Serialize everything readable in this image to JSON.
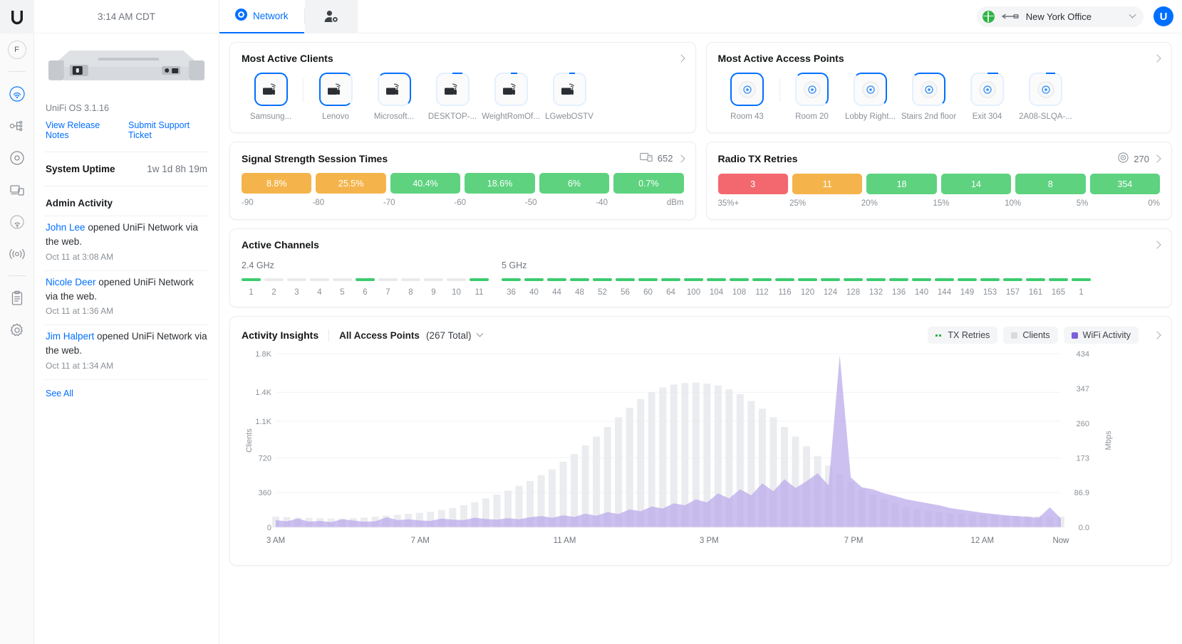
{
  "rail": {
    "logo_icon": "ubiquiti-logo-icon",
    "avatar_initial": "F",
    "items": [
      {
        "name": "wifi-dashboard-icon",
        "active": true
      },
      {
        "name": "topology-icon",
        "active": false
      },
      {
        "name": "devices-circle-icon",
        "active": false
      },
      {
        "name": "client-devices-icon",
        "active": false
      },
      {
        "name": "wifi-coverage-icon",
        "active": false
      },
      {
        "name": "radio-broadcast-icon",
        "active": false
      },
      {
        "name": "logs-clipboard-icon",
        "active": false
      },
      {
        "name": "settings-gear-icon",
        "active": false
      }
    ]
  },
  "topbar": {
    "tab_network": "Network",
    "tab_admin_icon": "user-admin-icon",
    "site_name": "New York Office",
    "site_status_icon": "globe-online-icon",
    "user_avatar_initial": "U"
  },
  "sidebar": {
    "clock": "3:14 AM CDT",
    "device_icon": "rackmount-gateway-icon",
    "os_version": "UniFi OS 3.1.16",
    "link_release_notes": "View Release Notes",
    "link_support_ticket": "Submit Support Ticket",
    "uptime_label": "System Uptime",
    "uptime_value": "1w 1d 8h 19m",
    "admin_activity_title": "Admin Activity",
    "activities": [
      {
        "user": "John Lee",
        "text": " opened UniFi Network via the web.",
        "time": "Oct 11 at 3:08 AM"
      },
      {
        "user": "Nicole Deer",
        "text": " opened UniFi Network via the web.",
        "time": "Oct 11 at 1:36 AM"
      },
      {
        "user": "Jim Halpert",
        "text": " opened UniFi Network via the web.",
        "time": "Oct 11 at 1:34 AM"
      }
    ],
    "see_all": "See All"
  },
  "most_active_clients": {
    "title": "Most Active Clients",
    "items": [
      {
        "label": "Samsung...",
        "ring": 100,
        "selected": true
      },
      {
        "label": "Lenovo",
        "ring": 78,
        "selected": false
      },
      {
        "label": "Microsoft...",
        "ring": 42,
        "selected": false
      },
      {
        "label": "DESKTOP-...",
        "ring": 12,
        "selected": false
      },
      {
        "label": "WeightRomOf...",
        "ring": 8,
        "selected": false
      },
      {
        "label": "LGwebOSTV",
        "ring": 7,
        "selected": false
      }
    ]
  },
  "most_active_aps": {
    "title": "Most Active Access Points",
    "items": [
      {
        "label": "Room 43",
        "ring": 100,
        "selected": true
      },
      {
        "label": "Room 20",
        "ring": 52,
        "selected": false
      },
      {
        "label": "Lobby Right...",
        "ring": 46,
        "selected": false
      },
      {
        "label": "Stairs 2nd floor",
        "ring": 40,
        "selected": false
      },
      {
        "label": "Exit 304",
        "ring": 18,
        "selected": false
      },
      {
        "label": "2A08-SLQA-...",
        "ring": 16,
        "selected": false
      }
    ]
  },
  "signal_strength": {
    "title": "Signal Strength Session Times",
    "metric_icon": "clients-screen-icon",
    "metric_value": "652",
    "segments": [
      {
        "value": "8.8%",
        "color": "#f5b44b"
      },
      {
        "value": "25.5%",
        "color": "#f5b44b"
      },
      {
        "value": "40.4%",
        "color": "#5ed27f"
      },
      {
        "value": "18.6%",
        "color": "#5ed27f"
      },
      {
        "value": "6%",
        "color": "#5ed27f"
      },
      {
        "value": "0.7%",
        "color": "#5ed27f"
      }
    ],
    "ticks": [
      "-90",
      "-80",
      "-70",
      "-60",
      "-50",
      "-40"
    ],
    "unit": "dBm"
  },
  "radio_tx_retries": {
    "title": "Radio TX Retries",
    "metric_icon": "access-point-target-icon",
    "metric_value": "270",
    "segments": [
      {
        "value": "3",
        "color": "#f2686e"
      },
      {
        "value": "11",
        "color": "#f5b44b"
      },
      {
        "value": "18",
        "color": "#5ed27f"
      },
      {
        "value": "14",
        "color": "#5ed27f"
      },
      {
        "value": "8",
        "color": "#5ed27f"
      },
      {
        "value": "354",
        "color": "#5ed27f"
      }
    ],
    "ticks": [
      "35%+",
      "25%",
      "20%",
      "15%",
      "10%",
      "5%"
    ],
    "unit": "0%"
  },
  "active_channels": {
    "title": "Active Channels",
    "band_24_label": "2.4 GHz",
    "band_5_label": "5 GHz",
    "band_24": [
      {
        "ch": "1",
        "active": true
      },
      {
        "ch": "2",
        "active": false
      },
      {
        "ch": "3",
        "active": false
      },
      {
        "ch": "4",
        "active": false
      },
      {
        "ch": "5",
        "active": false
      },
      {
        "ch": "6",
        "active": true
      },
      {
        "ch": "7",
        "active": false
      },
      {
        "ch": "8",
        "active": false
      },
      {
        "ch": "9",
        "active": false
      },
      {
        "ch": "10",
        "active": false
      },
      {
        "ch": "11",
        "active": true
      }
    ],
    "band_5": [
      {
        "ch": "36",
        "active": true
      },
      {
        "ch": "40",
        "active": true
      },
      {
        "ch": "44",
        "active": true
      },
      {
        "ch": "48",
        "active": true
      },
      {
        "ch": "52",
        "active": true
      },
      {
        "ch": "56",
        "active": true
      },
      {
        "ch": "60",
        "active": true
      },
      {
        "ch": "64",
        "active": true
      },
      {
        "ch": "100",
        "active": true
      },
      {
        "ch": "104",
        "active": true
      },
      {
        "ch": "108",
        "active": true
      },
      {
        "ch": "112",
        "active": true
      },
      {
        "ch": "116",
        "active": true
      },
      {
        "ch": "120",
        "active": true
      },
      {
        "ch": "124",
        "active": true
      },
      {
        "ch": "128",
        "active": true
      },
      {
        "ch": "132",
        "active": true
      },
      {
        "ch": "136",
        "active": true
      },
      {
        "ch": "140",
        "active": true
      },
      {
        "ch": "144",
        "active": true
      },
      {
        "ch": "149",
        "active": true
      },
      {
        "ch": "153",
        "active": true
      },
      {
        "ch": "157",
        "active": true
      },
      {
        "ch": "161",
        "active": true
      },
      {
        "ch": "165",
        "active": true
      },
      {
        "ch": "1",
        "active": true
      }
    ],
    "active_color": "#3ccb6e",
    "inactive_color": "#e8eaec"
  },
  "activity_insights": {
    "title": "Activity Insights",
    "selector_label": "All Access Points",
    "selector_count": "(267 Total)",
    "legend": [
      {
        "label": "TX Retries",
        "color": "#2fb344",
        "style": "dotted",
        "on": true
      },
      {
        "label": "Clients",
        "color": "#d8dade",
        "style": "solid",
        "on": true
      },
      {
        "label": "WiFi Activity",
        "color": "#7b61d8",
        "style": "solid",
        "on": true
      }
    ]
  },
  "chart_data": {
    "type": "area",
    "title": "Activity Insights",
    "xlabel": "",
    "ylabel": "Clients",
    "y2label": "Mbps",
    "x": [
      "3 AM",
      "7 AM",
      "11 AM",
      "3 PM",
      "7 PM",
      "12 AM",
      "Now"
    ],
    "x_ticks": [
      "3 AM",
      "7 AM",
      "11 AM",
      "3 PM",
      "7 PM",
      "12 AM",
      "Now"
    ],
    "y_ticks_left": [
      "0",
      "360",
      "720",
      "1.1K",
      "1.4K",
      "1.8K"
    ],
    "y_ticks_right": [
      "0.0",
      "86.9",
      "173",
      "260",
      "347",
      "434"
    ],
    "ylim": [
      0,
      1800
    ],
    "y2lim": [
      0,
      434
    ],
    "grid": false,
    "legend_position": "top-right",
    "series": [
      {
        "name": "Clients",
        "color": "#e8e9ec",
        "axis": "left",
        "values": [
          110,
          105,
          100,
          98,
          95,
          92,
          90,
          95,
          100,
          110,
          120,
          130,
          140,
          150,
          160,
          180,
          200,
          230,
          260,
          300,
          340,
          380,
          430,
          480,
          540,
          600,
          680,
          760,
          850,
          940,
          1040,
          1140,
          1240,
          1330,
          1400,
          1450,
          1480,
          1495,
          1500,
          1490,
          1470,
          1430,
          1380,
          1310,
          1230,
          1140,
          1040,
          940,
          840,
          740,
          640,
          550,
          470,
          400,
          340,
          290,
          250,
          215,
          190,
          170,
          155,
          145,
          138,
          132,
          128,
          124,
          120,
          118,
          116,
          114,
          112,
          110
        ]
      },
      {
        "name": "WiFi Activity",
        "color": "#b9a8ea",
        "axis": "right",
        "values": [
          18,
          15,
          22,
          14,
          16,
          13,
          20,
          17,
          14,
          15,
          25,
          18,
          20,
          17,
          16,
          22,
          19,
          18,
          24,
          21,
          19,
          23,
          20,
          25,
          28,
          24,
          30,
          26,
          34,
          29,
          38,
          33,
          45,
          40,
          52,
          47,
          60,
          55,
          70,
          62,
          85,
          72,
          95,
          80,
          110,
          90,
          120,
          98,
          115,
          135,
          105,
          430,
          125,
          100,
          95,
          85,
          78,
          70,
          65,
          60,
          55,
          48,
          44,
          40,
          36,
          33,
          30,
          28,
          26,
          24,
          50,
          22
        ]
      },
      {
        "name": "TX Retries",
        "color": "#2fb344",
        "axis": "right",
        "values": [
          0,
          0,
          0,
          0,
          0,
          0,
          0,
          0,
          0,
          0,
          0,
          0,
          0,
          0,
          0,
          0,
          0,
          0,
          0,
          0,
          0,
          0,
          0,
          0,
          0,
          0,
          0,
          0,
          0,
          0,
          0,
          0,
          0,
          0,
          0,
          0,
          0,
          0,
          0,
          0,
          0,
          0,
          0,
          0,
          0,
          0,
          0,
          0,
          0,
          0,
          0,
          0,
          0,
          0,
          0,
          0,
          0,
          0,
          0,
          0,
          0,
          0,
          0,
          0,
          0,
          0,
          0,
          0,
          0,
          0,
          0,
          0
        ]
      }
    ]
  }
}
